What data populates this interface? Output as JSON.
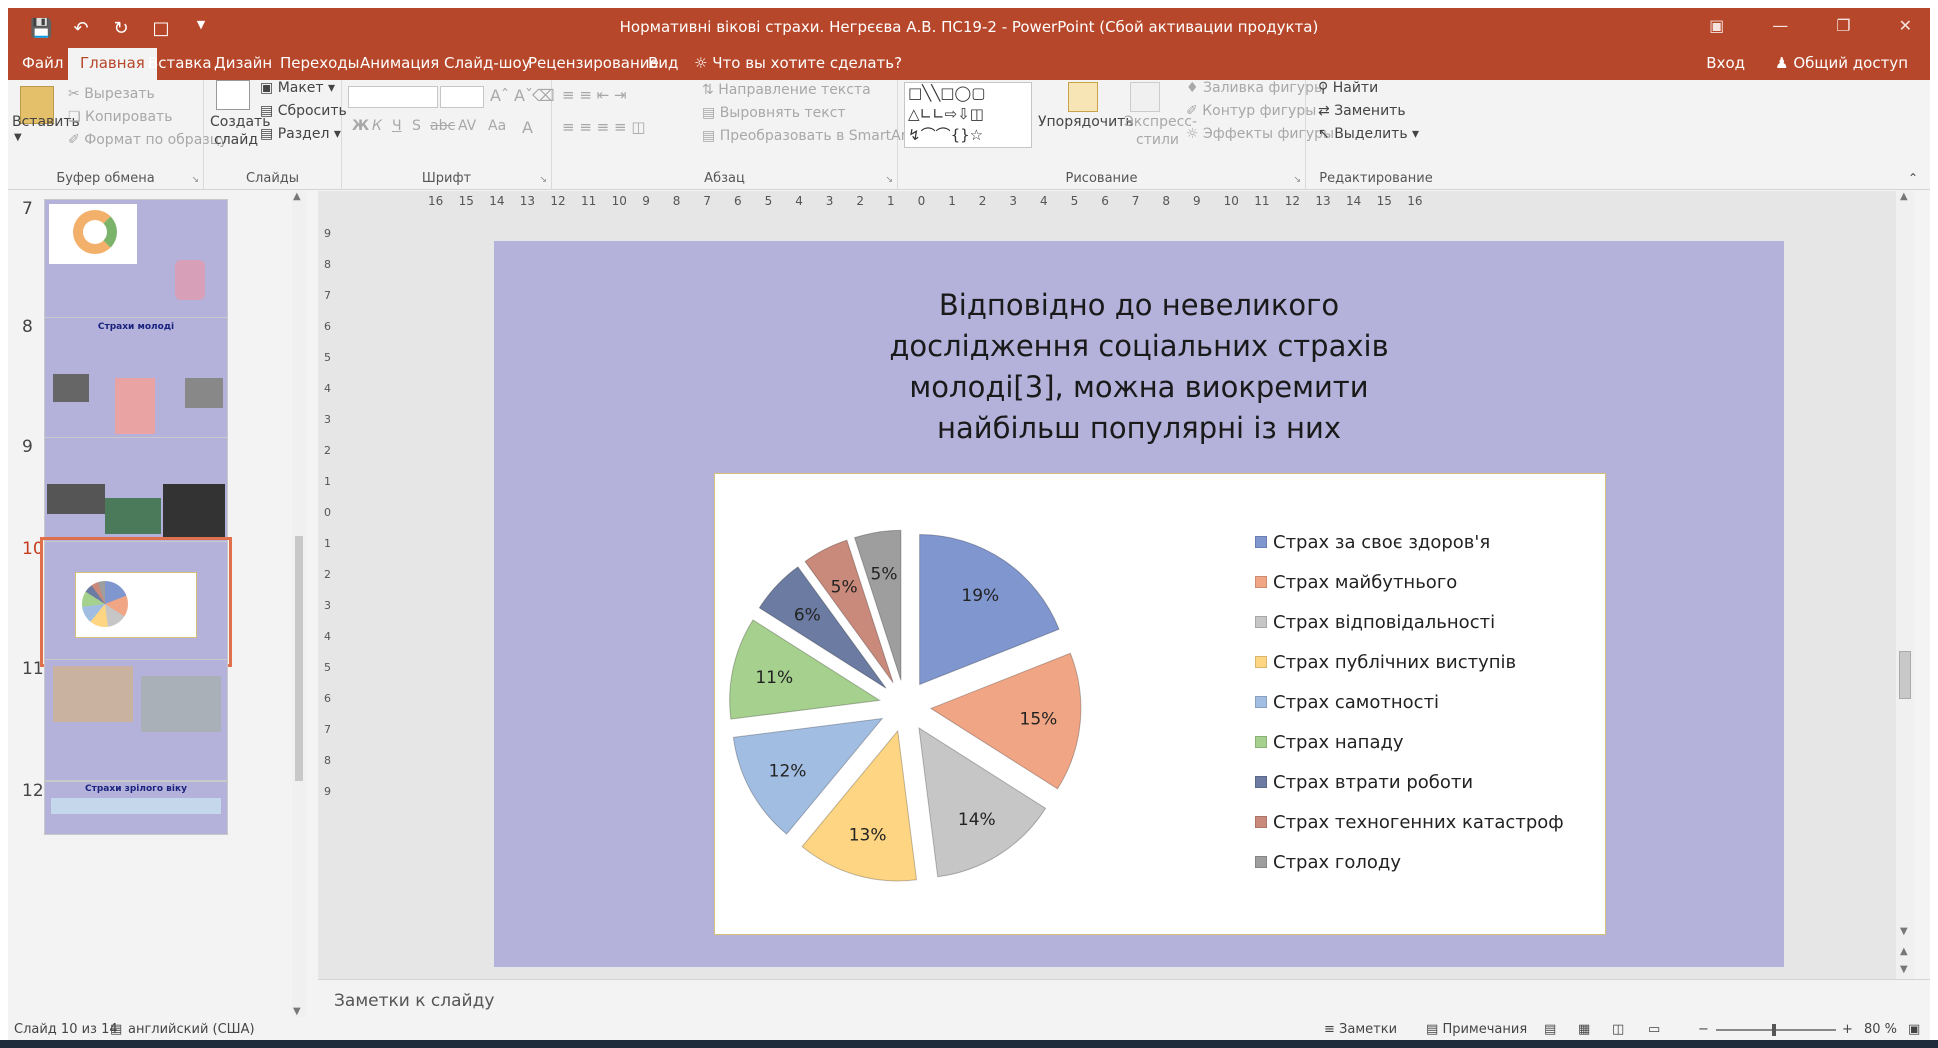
{
  "window": {
    "title": "Нормативні вікові страхи. Негрєєва А.В. ПС19-2 - PowerPoint (Сбой активации продукта)"
  },
  "tabs": {
    "file": "Файл",
    "home": "Главная",
    "insert": "Вставка",
    "design": "Дизайн",
    "transitions": "Переходы",
    "animation": "Анимация",
    "slideshow": "Слайд-шоу",
    "review": "Рецензирование",
    "view": "Вид",
    "tellme": "Что вы хотите сделать?",
    "signin": "Вход",
    "share": "Общий доступ"
  },
  "ribbon": {
    "clipboard": {
      "paste": "Вставить",
      "cut": "Вырезать",
      "copy": "Копировать",
      "format_painter": "Формат по образцу",
      "label": "Буфер обмена"
    },
    "slides": {
      "new_slide_1": "Создать",
      "new_slide_2": "слайд",
      "layout": "Макет",
      "reset": "Сбросить",
      "section": "Раздел",
      "label": "Слайды"
    },
    "font": {
      "bold": "Ж",
      "italic": "К",
      "underline": "Ч",
      "shadow": "S",
      "strike": "abc",
      "spacing": "AV",
      "case": "Aa",
      "label": "Шрифт"
    },
    "paragraph": {
      "text_direction": "Направление текста",
      "align_text": "Выровнять текст",
      "smartart": "Преобразовать в SmartArt",
      "label": "Абзац"
    },
    "drawing": {
      "arrange": "Упорядочить",
      "quick_styles_1": "Экспресс-",
      "quick_styles_2": "стили",
      "shape_fill": "Заливка фигуры",
      "shape_outline": "Контур фигуры",
      "shape_effects": "Эффекты фигуры",
      "label": "Рисование"
    },
    "editing": {
      "find": "Найти",
      "replace": "Заменить",
      "select": "Выделить",
      "label": "Редактирование"
    }
  },
  "ruler": {
    "labels": [
      "16",
      "15",
      "14",
      "13",
      "12",
      "11",
      "10",
      "9",
      "8",
      "7",
      "6",
      "5",
      "4",
      "3",
      "2",
      "1",
      "0",
      "1",
      "2",
      "3",
      "4",
      "5",
      "6",
      "7",
      "8",
      "9",
      "10",
      "11",
      "12",
      "13",
      "14",
      "15",
      "16"
    ],
    "vlabels": [
      "9",
      "8",
      "7",
      "6",
      "5",
      "4",
      "3",
      "2",
      "1",
      "0",
      "1",
      "2",
      "3",
      "4",
      "5",
      "6",
      "7",
      "8",
      "9"
    ]
  },
  "thumbnails": [
    {
      "num": "7",
      "title": ""
    },
    {
      "num": "8",
      "title": "Страхи молоді"
    },
    {
      "num": "9",
      "title": ""
    },
    {
      "num": "10",
      "title": ""
    },
    {
      "num": "11",
      "title": ""
    },
    {
      "num": "12",
      "title": "Страхи зрілого віку"
    }
  ],
  "slide": {
    "title_lines": [
      "Відповідно до невеликого",
      "дослідження соціальних страхів",
      "молоді[3], можна виокремити",
      "найбільш популярні із них"
    ]
  },
  "chart_data": {
    "type": "pie",
    "exploded": true,
    "legend_position": "right",
    "categories": [
      "Страх за своє здоров'я",
      "Страх майбутнього",
      "Страх відповідальності",
      "Страх публічних виступів",
      "Страх самотності",
      "Страх нападу",
      "Страх втрати роботи",
      "Страх техногенних катастроф",
      "Страх голоду"
    ],
    "values": [
      19,
      15,
      14,
      13,
      12,
      11,
      6,
      5,
      5
    ],
    "data_labels": [
      "19%",
      "15%",
      "14%",
      "13%",
      "12%",
      "11%",
      "6%",
      "5%",
      "5%"
    ],
    "colors": [
      "#8096cf",
      "#f0a585",
      "#c6c6c6",
      "#fed683",
      "#a1bde2",
      "#a5d08d",
      "#6b7ba1",
      "#c9897b",
      "#9e9e9e"
    ]
  },
  "notes": {
    "placeholder": "Заметки к слайду"
  },
  "status": {
    "slide": "Слайд 10 из 14",
    "language": "английский (США)",
    "notes": "Заметки",
    "comments": "Примечания",
    "zoom": "80 %"
  }
}
